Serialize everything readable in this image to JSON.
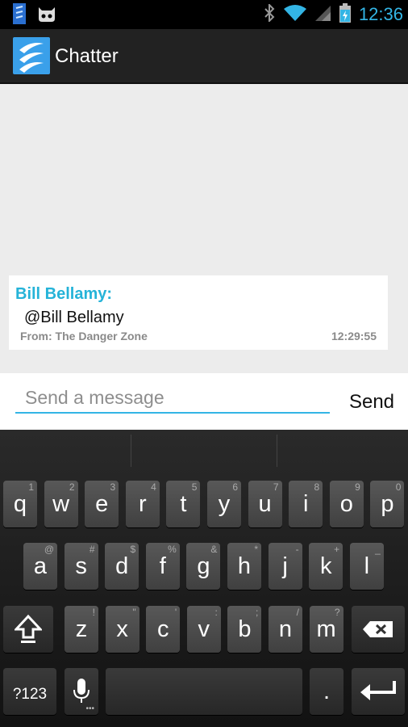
{
  "status_bar": {
    "time": "12:36"
  },
  "app": {
    "title": "Chatter"
  },
  "message": {
    "sender": "Bill Bellamy:",
    "body": "@Bill Bellamy",
    "from": "From: The Danger Zone",
    "time": "12:29:55"
  },
  "compose": {
    "placeholder": "Send a message",
    "send_label": "Send"
  },
  "keyboard": {
    "row1": [
      {
        "key": "q",
        "hint": "1"
      },
      {
        "key": "w",
        "hint": "2"
      },
      {
        "key": "e",
        "hint": "3"
      },
      {
        "key": "r",
        "hint": "4"
      },
      {
        "key": "t",
        "hint": "5"
      },
      {
        "key": "y",
        "hint": "6"
      },
      {
        "key": "u",
        "hint": "7"
      },
      {
        "key": "i",
        "hint": "8"
      },
      {
        "key": "o",
        "hint": "9"
      },
      {
        "key": "p",
        "hint": "0"
      }
    ],
    "row2": [
      {
        "key": "a",
        "hint": "@"
      },
      {
        "key": "s",
        "hint": "#"
      },
      {
        "key": "d",
        "hint": "$"
      },
      {
        "key": "f",
        "hint": "%"
      },
      {
        "key": "g",
        "hint": "&"
      },
      {
        "key": "h",
        "hint": "*"
      },
      {
        "key": "j",
        "hint": "-"
      },
      {
        "key": "k",
        "hint": "+"
      },
      {
        "key": "l",
        "hint": "_"
      }
    ],
    "row3": [
      {
        "key": "z",
        "hint": "!"
      },
      {
        "key": "x",
        "hint": "\""
      },
      {
        "key": "c",
        "hint": "'"
      },
      {
        "key": "v",
        "hint": ":"
      },
      {
        "key": "b",
        "hint": ";"
      },
      {
        "key": "n",
        "hint": "/"
      },
      {
        "key": "m",
        "hint": "?"
      }
    ],
    "symbols_label": "?123",
    "period_label": "."
  },
  "colors": {
    "accent": "#33b5e5",
    "sender": "#25b3d8",
    "app_icon": "#3aa0ea"
  }
}
